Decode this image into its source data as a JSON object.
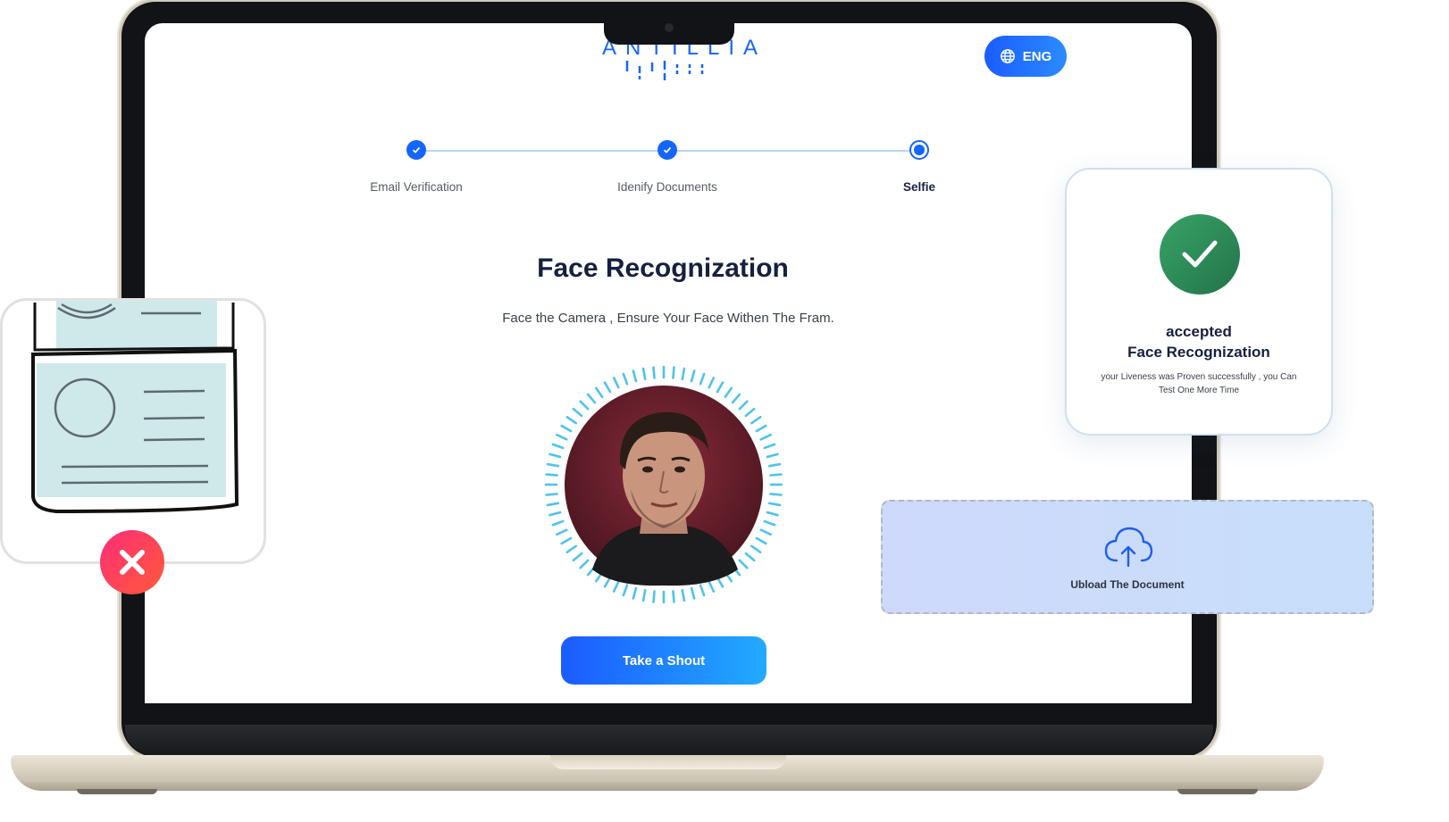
{
  "app": {
    "language_button": "ENG",
    "logo_text": "ANTILLIA"
  },
  "stepper": {
    "steps": [
      {
        "label": "Email Verification",
        "state": "completed"
      },
      {
        "label": "Idenify Documents",
        "state": "completed"
      },
      {
        "label": "Selfie",
        "state": "current"
      }
    ]
  },
  "main": {
    "title": "Face Recognization",
    "subtitle": "Face the Camera , Ensure Your Face Withen The Fram.",
    "shoot_button": "Take a Shout"
  },
  "accept_card": {
    "title_line1": "accepted",
    "title_line2": "Face Recognization",
    "description": "your Liveness was Proven successfully , you Can Test One More Time",
    "icon": "check-icon"
  },
  "upload": {
    "label": "Ubload The Document",
    "icon": "cloud-upload-icon"
  },
  "reject": {
    "icon": "close-icon"
  },
  "colors": {
    "accent": "#1565ff",
    "success": "#2e8b57",
    "danger": "#ff3b6b"
  }
}
